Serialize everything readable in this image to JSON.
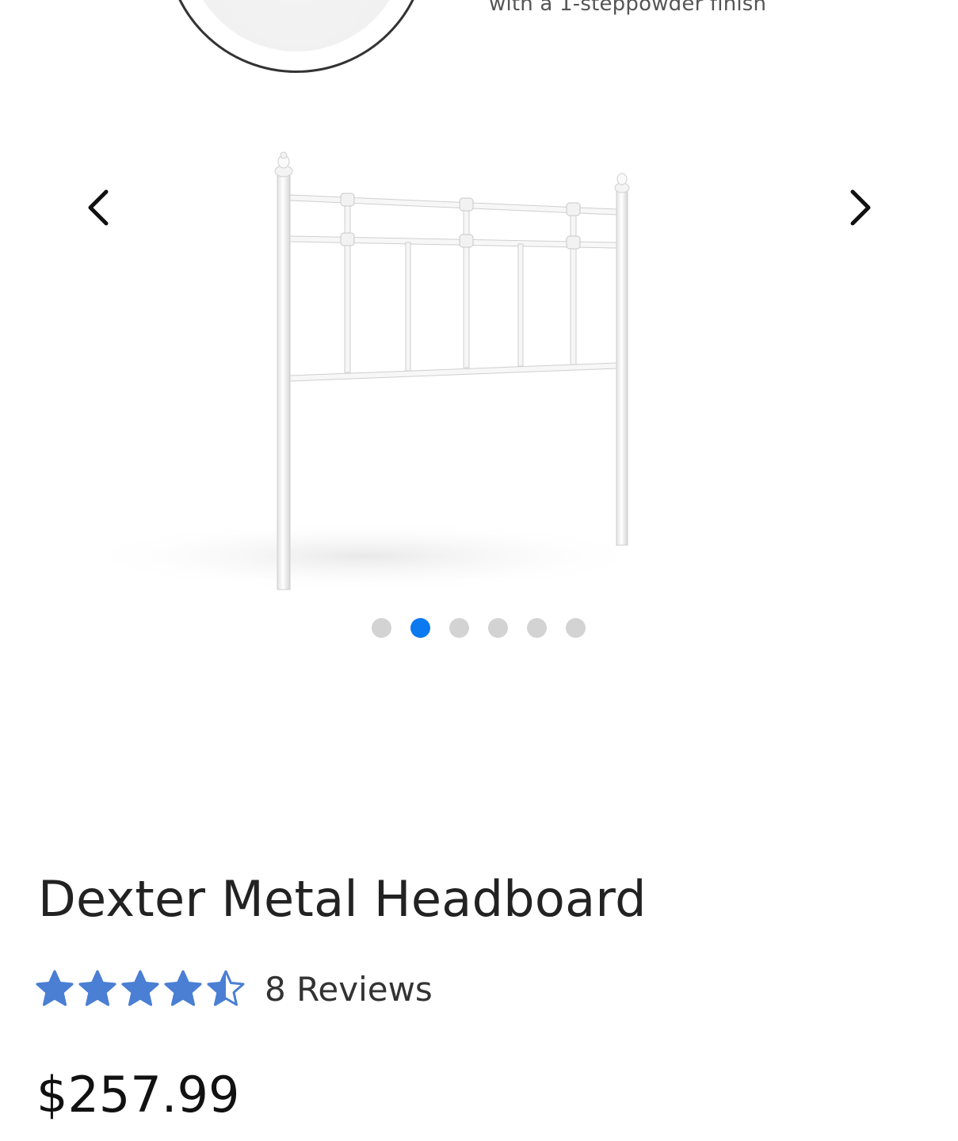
{
  "gallery": {
    "slide_caption": "with a 1-steppowder finish",
    "prev_icon": "chevron-left-icon",
    "next_icon": "chevron-right-icon",
    "image_alt": "Dexter Metal Headboard",
    "dot_count": 6,
    "active_dot": 2,
    "active_color": "#0b79f0",
    "inactive_color": "#d3d3d3"
  },
  "product": {
    "title": "Dexter Metal Headboard",
    "rating": 4.5,
    "rating_max": 5,
    "star_color": "#4a7fd4",
    "reviews_label": "8 Reviews",
    "price": "$257.99"
  }
}
